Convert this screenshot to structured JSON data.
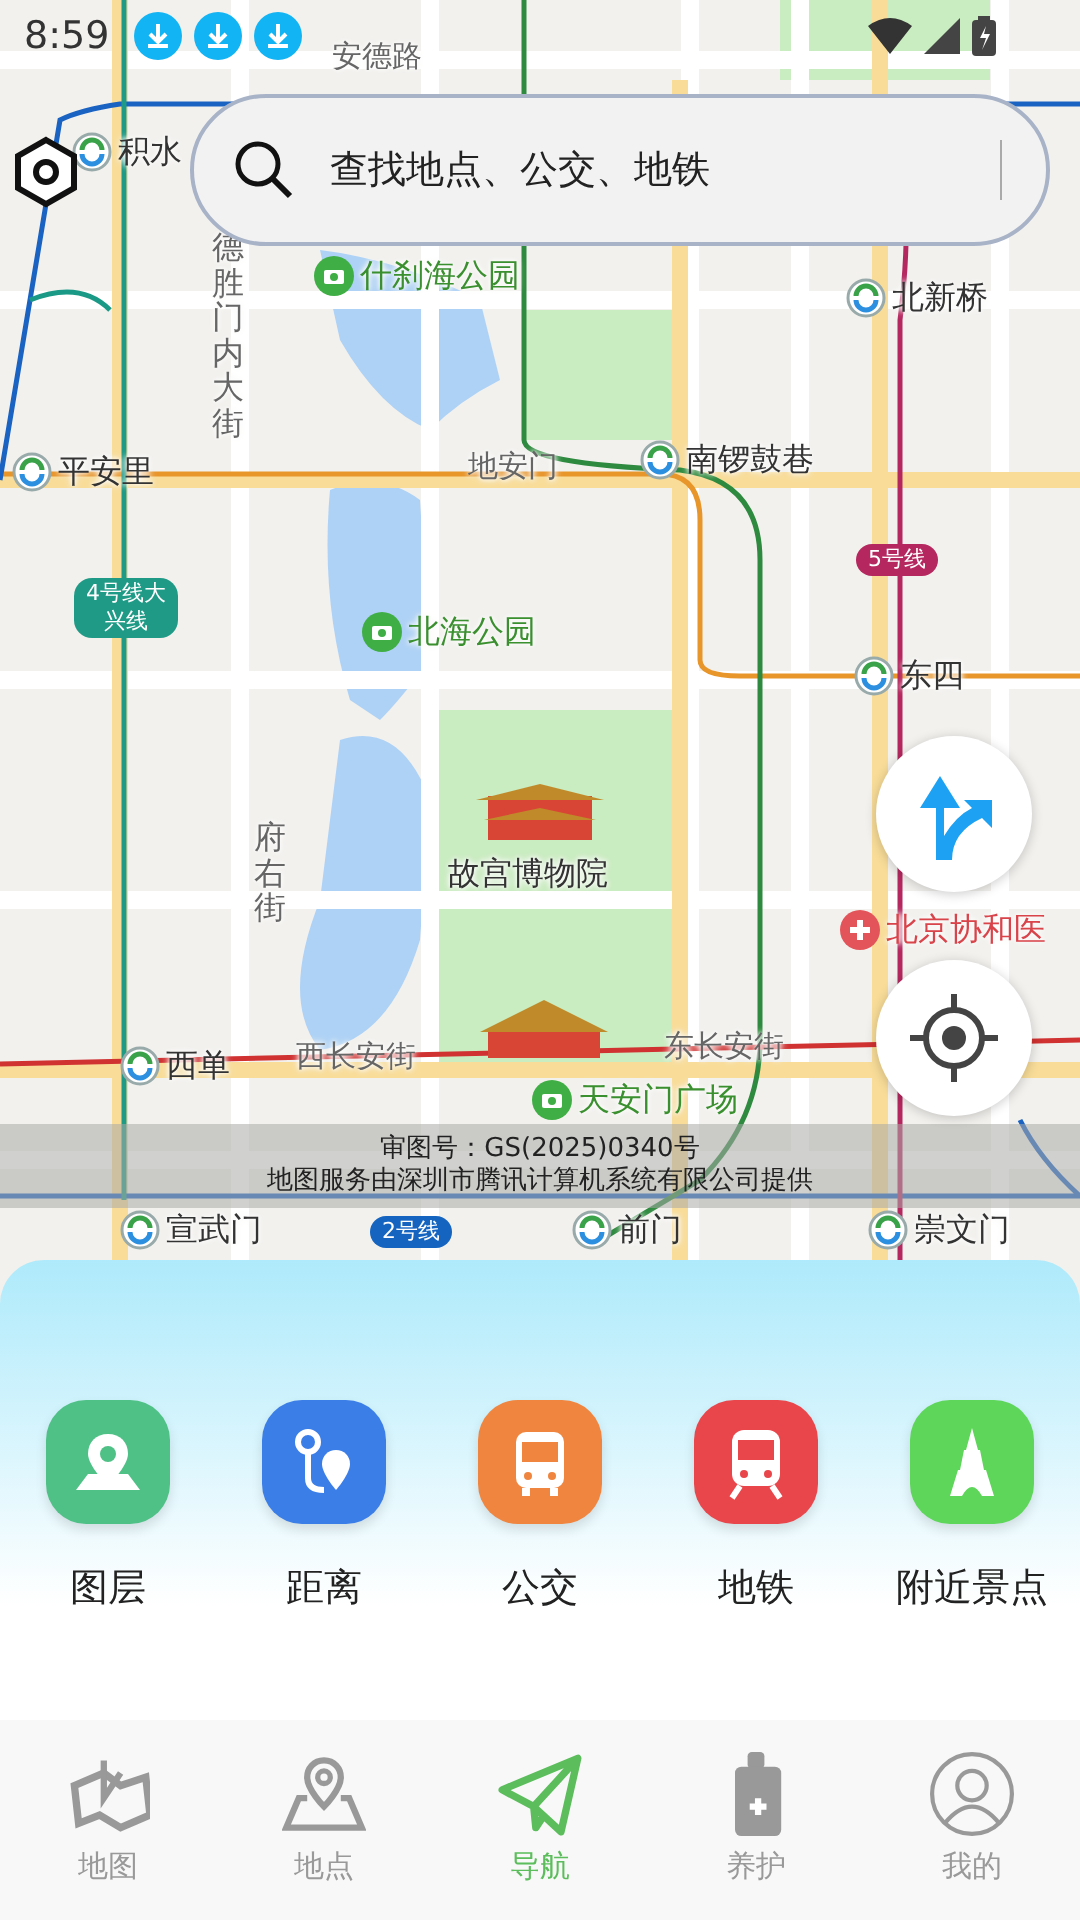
{
  "status_bar": {
    "time": "8:59"
  },
  "search": {
    "placeholder": "查找地点、公交、地铁"
  },
  "map": {
    "labels": [
      {
        "kind": "road",
        "text": "安德路"
      },
      {
        "kind": "station",
        "text": "积水"
      },
      {
        "kind": "vertical-road",
        "text": "德胜门内大街"
      },
      {
        "kind": "park",
        "text": "什刹海公园"
      },
      {
        "kind": "station",
        "text": "北新桥"
      },
      {
        "kind": "station",
        "text": "平安里"
      },
      {
        "kind": "road",
        "text": "地安门"
      },
      {
        "kind": "station",
        "text": "南锣鼓巷"
      },
      {
        "kind": "line-badge",
        "text": "5号线",
        "color": "#b5285f"
      },
      {
        "kind": "line-badge",
        "text": "4号线大兴线",
        "color": "#1f9a86"
      },
      {
        "kind": "park",
        "text": "北海公园"
      },
      {
        "kind": "station",
        "text": "东四"
      },
      {
        "kind": "vertical-road",
        "text": "府右街"
      },
      {
        "kind": "landmark",
        "text": "故宫博物院"
      },
      {
        "kind": "hospital",
        "text": "北京协和医"
      },
      {
        "kind": "station",
        "text": "西单"
      },
      {
        "kind": "road",
        "text": "西长安街"
      },
      {
        "kind": "road",
        "text": "东长安街"
      },
      {
        "kind": "park",
        "text": "天安门广场"
      },
      {
        "kind": "station",
        "text": "宣武门"
      },
      {
        "kind": "line-badge",
        "text": "2号线",
        "color": "#1565c0"
      },
      {
        "kind": "station",
        "text": "前门"
      },
      {
        "kind": "station",
        "text": "崇文门"
      }
    ],
    "notice": [
      "审图号：GS(2025)0340号",
      "地图服务由深圳市腾讯计算机系统有限公司提供"
    ]
  },
  "tools": [
    {
      "label": "图层",
      "color": "#4fc186"
    },
    {
      "label": "距离",
      "color": "#3c7ee8"
    },
    {
      "label": "公交",
      "color": "#f08540"
    },
    {
      "label": "地铁",
      "color": "#e9464c"
    },
    {
      "label": "附近景点",
      "color": "#5ed65a"
    }
  ],
  "tabs": [
    {
      "label": "地图",
      "selected": false
    },
    {
      "label": "地点",
      "selected": false
    },
    {
      "label": "导航",
      "selected": true
    },
    {
      "label": "养护",
      "selected": false
    },
    {
      "label": "我的",
      "selected": false
    }
  ]
}
